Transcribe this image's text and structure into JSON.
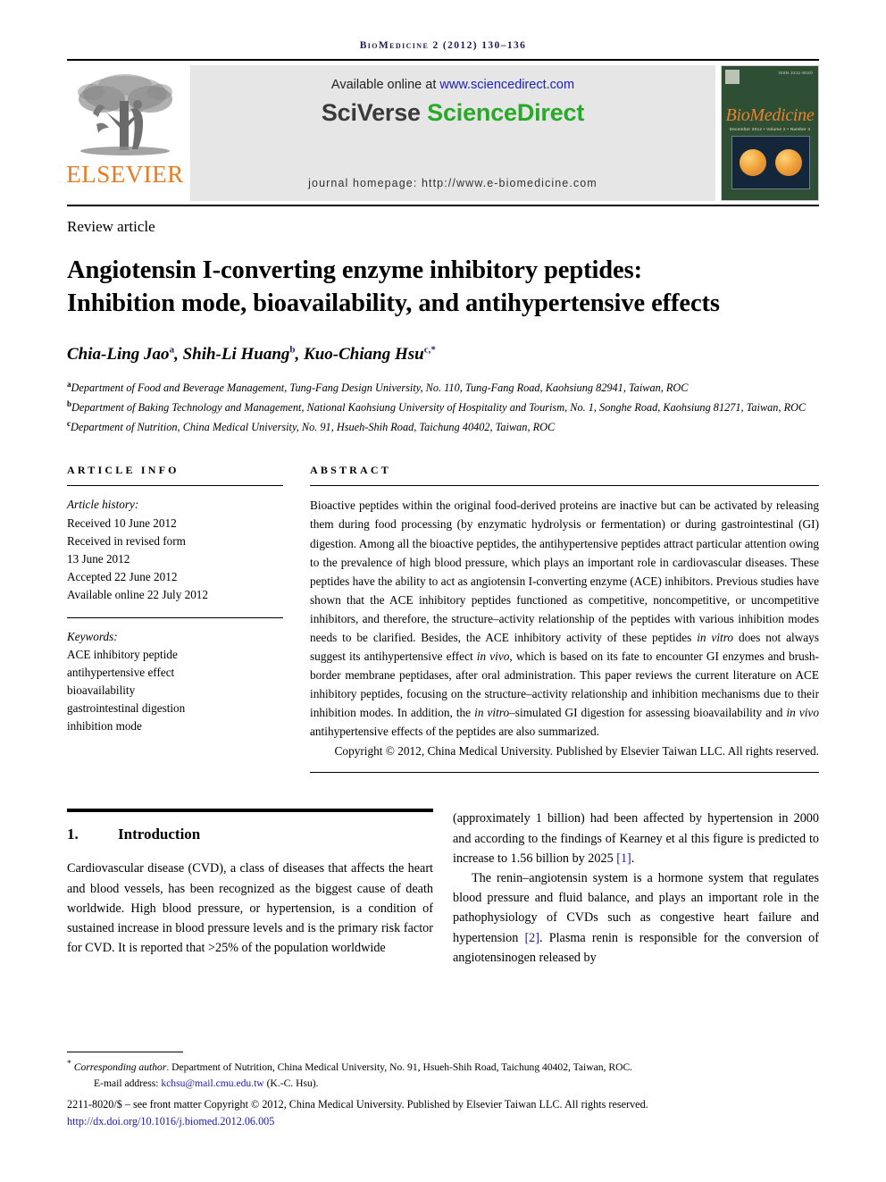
{
  "running_head": "BioMedicine 2 (2012) 130–136",
  "masthead": {
    "publisher_name": "ELSEVIER",
    "available_prefix": "Available online at ",
    "available_url": "www.sciencedirect.com",
    "brand_part1": "SciVerse ",
    "brand_part2": "ScienceDirect",
    "homepage": "journal homepage: http://www.e-biomedicine.com",
    "cover": {
      "title": "BioMedicine",
      "subtitle": "December 2012  •  Volume 2  •  Number 4",
      "corner_label": "ISSN 2211-8020"
    }
  },
  "article": {
    "type_label": "Review article",
    "title_line1": "Angiotensin I-converting enzyme inhibitory peptides:",
    "title_line2": "Inhibition mode, bioavailability, and antihypertensive effects",
    "authors": [
      {
        "name": "Chia-Ling Jao",
        "sup": "a",
        "sep": ", "
      },
      {
        "name": "Shih-Li Huang",
        "sup": "b",
        "sep": ", "
      },
      {
        "name": "Kuo-Chiang Hsu",
        "sup": "c,*",
        "sep": ""
      }
    ],
    "affiliations": [
      {
        "mark": "a",
        "text": "Department of Food and Beverage Management, Tung-Fang Design University, No. 110, Tung-Fang Road, Kaohsiung 82941, Taiwan, ROC"
      },
      {
        "mark": "b",
        "text": "Department of Baking Technology and Management, National Kaohsiung University of Hospitality and Tourism, No. 1, Songhe Road, Kaohsiung 81271, Taiwan, ROC"
      },
      {
        "mark": "c",
        "text": "Department of Nutrition, China Medical University, No. 91, Hsueh-Shih Road, Taichung 40402, Taiwan, ROC"
      }
    ]
  },
  "article_info": {
    "heading": "ARTICLE INFO",
    "history_label": "Article history:",
    "history": [
      "Received 10 June 2012",
      "Received in revised form",
      "13 June 2012",
      "Accepted 22 June 2012",
      "Available online 22 July 2012"
    ],
    "keywords_label": "Keywords:",
    "keywords": [
      "ACE inhibitory peptide",
      "antihypertensive effect",
      "bioavailability",
      "gastrointestinal digestion",
      "inhibition mode"
    ]
  },
  "abstract": {
    "heading": "ABSTRACT",
    "body_part1": "Bioactive peptides within the original food-derived proteins are inactive but can be activated by releasing them during food processing (by enzymatic hydrolysis or fermentation) or during gastrointestinal (GI) digestion. Among all the bioactive peptides, the antihypertensive peptides attract particular attention owing to the prevalence of high blood pressure, which plays an important role in cardiovascular diseases. These peptides have the ability to act as angiotensin I-converting enzyme (ACE) inhibitors. Previous studies have shown that the ACE inhibitory peptides functioned as competitive, noncompetitive, or uncompetitive inhibitors, and therefore, the structure–activity relationship of the peptides with various inhibition modes needs to be clarified. Besides, the ACE inhibitory activity of these peptides ",
    "italic1": "in vitro",
    "body_part2": " does not always suggest its antihypertensive effect ",
    "italic2": "in vivo",
    "body_part3": ", which is based on its fate to encounter GI enzymes and brush-border membrane peptidases, after oral administration. This paper reviews the current literature on ACE inhibitory peptides, focusing on the structure–activity relationship and inhibition mechanisms due to their inhibition modes. In addition, the ",
    "italic3": "in vitro",
    "body_part4": "–simulated GI digestion for assessing bioavailability and ",
    "italic4": "in vivo",
    "body_part5": " antihypertensive effects of the peptides are also summarized.",
    "copyright": "Copyright © 2012, China Medical University. Published by Elsevier Taiwan LLC. All rights reserved."
  },
  "body": {
    "section_number": "1.",
    "section_title": "Introduction",
    "left_column": "Cardiovascular disease (CVD), a class of diseases that affects the heart and blood vessels, has been recognized as the biggest cause of death worldwide. High blood pressure, or hypertension, is a condition of sustained increase in blood pressure levels and is the primary risk factor for CVD. It is reported that >25% of the population worldwide",
    "right_para1_a": "(approximately 1 billion) had been affected by hypertension in 2000 and according to the findings of Kearney et al this figure is predicted to increase to 1.56 billion by 2025 ",
    "right_para1_ref": "[1]",
    "right_para1_b": ".",
    "right_para2_a": "The renin–angiotensin system is a hormone system that regulates blood pressure and fluid balance, and plays an important role in the pathophysiology of CVDs such as congestive heart failure and hypertension ",
    "right_para2_ref": "[2]",
    "right_para2_b": ". Plasma renin is responsible for the conversion of angiotensinogen released by"
  },
  "footer": {
    "corr_marker": "*",
    "corr_label": "Corresponding author",
    "corr_address": ". Department of Nutrition, China Medical University, No. 91, Hsueh-Shih Road, Taichung 40402, Taiwan, ROC.",
    "email_label": "E-mail address: ",
    "email": "kchsu@mail.cmu.edu.tw",
    "email_suffix": " (K.-C. Hsu).",
    "issn_line": "2211-8020/$ – see front matter Copyright © 2012, China Medical University. Published by Elsevier Taiwan LLC. All rights reserved.",
    "doi": "http://dx.doi.org/10.1016/j.biomed.2012.06.005"
  }
}
